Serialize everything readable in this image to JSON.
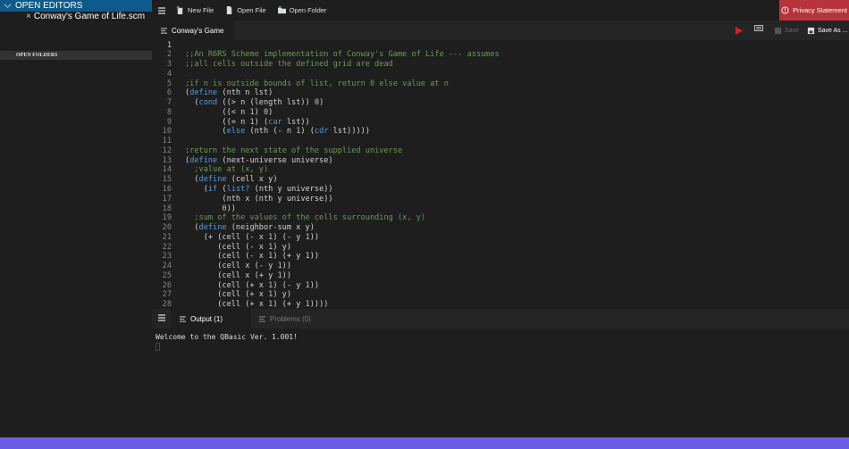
{
  "sidebar": {
    "open_editors": "OPEN EDITORS",
    "file": "Conway's Game of Life.scm",
    "close": "×",
    "open_folders": "OPEN FOLDERS"
  },
  "toolbar": {
    "new_file": "New File",
    "open_file": "Open File",
    "open_folder": "Open Folder",
    "privacy": "Privacy Statement"
  },
  "tabs": {
    "active": "Conway's Game",
    "save": "Save",
    "save_as": "Save As ..."
  },
  "code": [
    [],
    [
      [
        ";;An R6RS Scheme implementation of Conway's Game of Life --- assumes",
        "c"
      ]
    ],
    [
      [
        ";;all cells outside the defined grid are dead",
        "c"
      ]
    ],
    [],
    [
      [
        ";if n is outside bounds of list, return 0 else value at n",
        "c"
      ]
    ],
    [
      [
        "(",
        ""
      ],
      [
        "define",
        "k"
      ],
      [
        " (nth n lst)",
        ""
      ]
    ],
    [
      [
        "  (",
        ""
      ],
      [
        "cond",
        "k"
      ],
      [
        " ((> n (length lst)) ",
        ""
      ],
      [
        "0",
        "n"
      ],
      [
        ")",
        ""
      ]
    ],
    [
      [
        "        ((< n ",
        ""
      ],
      [
        "1",
        "n"
      ],
      [
        ") ",
        ""
      ],
      [
        "0",
        "n"
      ],
      [
        ")",
        ""
      ]
    ],
    [
      [
        "        ((= n ",
        ""
      ],
      [
        "1",
        "n"
      ],
      [
        ") (",
        ""
      ],
      [
        "car",
        "k"
      ],
      [
        " lst))",
        ""
      ]
    ],
    [
      [
        "        (",
        ""
      ],
      [
        "else",
        "k"
      ],
      [
        " (nth (- n ",
        ""
      ],
      [
        "1",
        "n"
      ],
      [
        ") (",
        ""
      ],
      [
        "cdr",
        "k"
      ],
      [
        " lst)))))",
        ""
      ]
    ],
    [],
    [
      [
        ";return the next state of the supplied universe",
        "c"
      ]
    ],
    [
      [
        "(",
        ""
      ],
      [
        "define",
        "k"
      ],
      [
        " (next-universe universe)",
        ""
      ]
    ],
    [
      [
        "  ;value at (x, y)",
        "c"
      ]
    ],
    [
      [
        "  (",
        ""
      ],
      [
        "define",
        "k"
      ],
      [
        " (cell x y)",
        ""
      ]
    ],
    [
      [
        "    (",
        ""
      ],
      [
        "if",
        "k"
      ],
      [
        " (",
        ""
      ],
      [
        "list?",
        "k"
      ],
      [
        " (nth y universe))",
        ""
      ]
    ],
    [
      [
        "        (nth x (nth y universe))",
        ""
      ]
    ],
    [
      [
        "        ",
        ""
      ],
      [
        "0",
        "n"
      ],
      [
        "))",
        ""
      ]
    ],
    [
      [
        "  ;sum of the values of the cells surrounding (x, y)",
        "c"
      ]
    ],
    [
      [
        "  (",
        ""
      ],
      [
        "define",
        "k"
      ],
      [
        " (neighbor-sum x y)",
        ""
      ]
    ],
    [
      [
        "    (+ (cell (- x ",
        ""
      ],
      [
        "1",
        "n"
      ],
      [
        ") (- y ",
        ""
      ],
      [
        "1",
        "n"
      ],
      [
        "))",
        ""
      ]
    ],
    [
      [
        "       (cell (- x ",
        ""
      ],
      [
        "1",
        "n"
      ],
      [
        ") y)",
        ""
      ]
    ],
    [
      [
        "       (cell (- x ",
        ""
      ],
      [
        "1",
        "n"
      ],
      [
        ") (+ y ",
        ""
      ],
      [
        "1",
        "n"
      ],
      [
        "))",
        ""
      ]
    ],
    [
      [
        "       (cell x (- y ",
        ""
      ],
      [
        "1",
        "n"
      ],
      [
        "))",
        ""
      ]
    ],
    [
      [
        "       (cell x (+ y ",
        ""
      ],
      [
        "1",
        "n"
      ],
      [
        "))",
        ""
      ]
    ],
    [
      [
        "       (cell (+ x ",
        ""
      ],
      [
        "1",
        "n"
      ],
      [
        ") (- y ",
        ""
      ],
      [
        "1",
        "n"
      ],
      [
        "))",
        ""
      ]
    ],
    [
      [
        "       (cell (+ x ",
        ""
      ],
      [
        "1",
        "n"
      ],
      [
        ") y)",
        ""
      ]
    ],
    [
      [
        "       (cell (+ x ",
        ""
      ],
      [
        "1",
        "n"
      ],
      [
        ") (+ y ",
        ""
      ],
      [
        "1",
        "n"
      ],
      [
        "))))",
        ""
      ]
    ]
  ],
  "panel": {
    "output": "Output (1)",
    "problems": "Problems (0)",
    "text": "Welcome to the QBasic  Ver. 1.001!"
  }
}
